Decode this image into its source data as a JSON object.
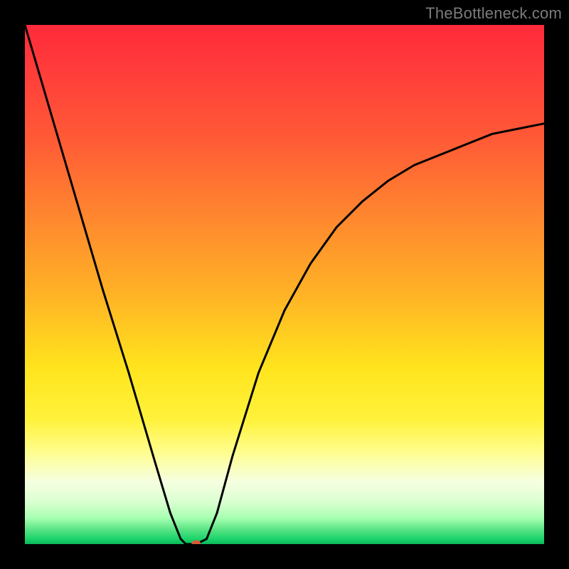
{
  "watermark": "TheBottleneck.com",
  "chart_data": {
    "type": "line",
    "title": "",
    "xlabel": "",
    "ylabel": "",
    "xlim": [
      0,
      100
    ],
    "ylim": [
      0,
      100
    ],
    "grid": false,
    "series": [
      {
        "name": "curve",
        "x": [
          0,
          5,
          10,
          15,
          20,
          25,
          28,
          30,
          31,
          33,
          35,
          37,
          40,
          45,
          50,
          55,
          60,
          65,
          70,
          75,
          80,
          85,
          90,
          95,
          100
        ],
        "y": [
          100,
          83,
          66,
          49,
          33,
          16,
          6,
          1,
          0,
          0,
          1,
          6,
          17,
          33,
          45,
          54,
          61,
          66,
          70,
          73,
          75,
          77,
          79,
          80,
          81
        ]
      }
    ],
    "marker": {
      "x": 33,
      "y": 0
    },
    "background": "rainbow-vertical-gradient"
  }
}
